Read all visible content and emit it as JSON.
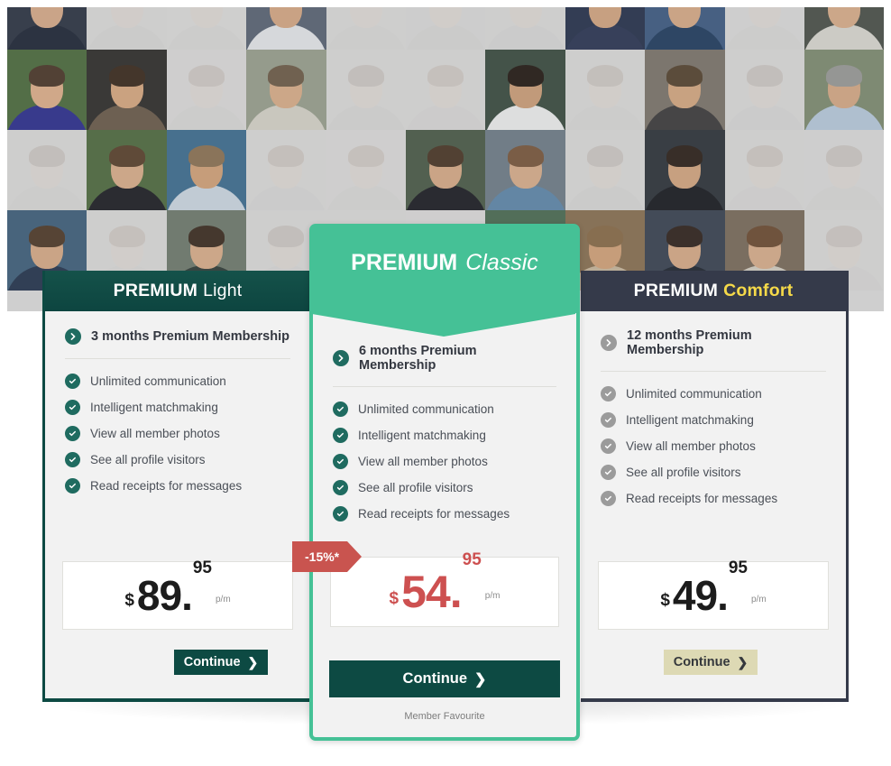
{
  "hero": {
    "name": "member-photo-mosaic",
    "columns": 11,
    "rows": 4,
    "tiles": [
      {
        "faded": false,
        "skin": "#d9ab87",
        "hair": "#3c2a1e",
        "bg": "#2c3340",
        "cloth": "#1d2433"
      },
      {
        "faded": true,
        "skin": "#e2bda0",
        "hair": "#6b4a30",
        "bg": "#c9c9c4",
        "cloth": "#b5b5ae"
      },
      {
        "faded": true,
        "skin": "#e5c2a6",
        "hair": "#8a6340",
        "bg": "#d0cfc9",
        "cloth": "#bdbcb6"
      },
      {
        "faded": false,
        "skin": "#d8a882",
        "hair": "#2e2119",
        "bg": "#5a6472",
        "cloth": "#e8e9ea"
      },
      {
        "faded": true,
        "skin": "#e6c4a8",
        "hair": "#7a5336",
        "bg": "#cdccc6",
        "cloth": "#b8b7b1"
      },
      {
        "faded": true,
        "skin": "#e3bfa3",
        "hair": "#4d372a",
        "bg": "#c6c5bf",
        "cloth": "#b2b1ab"
      },
      {
        "faded": true,
        "skin": "#e4c1a5",
        "hair": "#6f4d33",
        "bg": "#cbcac4",
        "cloth": "#b6b5af"
      },
      {
        "faded": false,
        "skin": "#d6a67f",
        "hair": "#34241a",
        "bg": "#253049",
        "cloth": "#2a3450"
      },
      {
        "faded": false,
        "skin": "#d9ab85",
        "hair": "#46301f",
        "bg": "#3d5a80",
        "cloth": "#1f3b5c"
      },
      {
        "faded": true,
        "skin": "#e5c3a7",
        "hair": "#7d5738",
        "bg": "#cecdc7",
        "cloth": "#b9b8b2"
      },
      {
        "faded": false,
        "skin": "#dcae88",
        "hair": "#56402c",
        "bg": "#4a4f46",
        "cloth": "#dcd9d0"
      },
      {
        "faded": false,
        "skin": "#e0b088",
        "hair": "#4b3524",
        "bg": "#4c6b3a",
        "cloth": "#2b2d8c"
      },
      {
        "faded": false,
        "skin": "#d9a87e",
        "hair": "#3a2819",
        "bg": "#2e2b27",
        "cloth": "#6a5a47"
      },
      {
        "faded": true,
        "skin": "#e6c5aa",
        "hair": "#7b5538",
        "bg": "#cfcec8",
        "cloth": "#bab9b3"
      },
      {
        "faded": false,
        "skin": "#dcae87",
        "hair": "#6e5b45",
        "bg": "#9aa08c",
        "cloth": "#d8d4c8"
      },
      {
        "faded": true,
        "skin": "#e3c0a4",
        "hair": "#6a4830",
        "bg": "#c8c7c1",
        "cloth": "#b4b3ad"
      },
      {
        "faded": true,
        "skin": "#e5c2a6",
        "hair": "#805a3b",
        "bg": "#cccbc5",
        "cloth": "#b7b6b0"
      },
      {
        "faded": false,
        "skin": "#cf9f76",
        "hair": "#22170f",
        "bg": "#3a4a3c",
        "cloth": "#f0f0ee"
      },
      {
        "faded": true,
        "skin": "#e4c1a5",
        "hair": "#74502f",
        "bg": "#cdccc6",
        "cloth": "#b8b7b1"
      },
      {
        "faded": false,
        "skin": "#d7a87f",
        "hair": "#55422c",
        "bg": "#7d7468",
        "cloth": "#3c3a38"
      },
      {
        "faded": true,
        "skin": "#e6c4a8",
        "hair": "#6d4b31",
        "bg": "#cbcac4",
        "cloth": "#b6b5af"
      },
      {
        "faded": false,
        "skin": "#d8aa83",
        "hair": "#9a9a96",
        "bg": "#7f8c6e",
        "cloth": "#b9cbdc"
      },
      {
        "faded": true,
        "skin": "#e5c3a7",
        "hair": "#6b4930",
        "bg": "#cdccc6",
        "cloth": "#b8b7b1"
      },
      {
        "faded": false,
        "skin": "#dcae88",
        "hair": "#5a4028",
        "bg": "#4f6b3c",
        "cloth": "#1c1c20"
      },
      {
        "faded": false,
        "skin": "#d5a377",
        "hair": "#8d7250",
        "bg": "#3d6d8e",
        "cloth": "#cfd9e2"
      },
      {
        "faded": true,
        "skin": "#e4c1a5",
        "hair": "#7a5436",
        "bg": "#cbcac4",
        "cloth": "#b6b5af"
      },
      {
        "faded": true,
        "skin": "#e6c5a9",
        "hair": "#82593a",
        "bg": "#cfcec8",
        "cloth": "#bab9b3"
      },
      {
        "faded": false,
        "skin": "#d9ab85",
        "hair": "#4a3522",
        "bg": "#4b5a44",
        "cloth": "#1b1b1f"
      },
      {
        "faded": false,
        "skin": "#dbae89",
        "hair": "#7a5638",
        "bg": "#6f7c86",
        "cloth": "#5f87a8"
      },
      {
        "faded": true,
        "skin": "#e3c0a4",
        "hair": "#6c4a31",
        "bg": "#c9c8c2",
        "cloth": "#b5b4ae"
      },
      {
        "faded": false,
        "skin": "#d6a67e",
        "hair": "#2b1e15",
        "bg": "#2d3136",
        "cloth": "#17181c"
      },
      {
        "faded": true,
        "skin": "#e5c2a6",
        "hair": "#785233",
        "bg": "#cccbc5",
        "cloth": "#b7b6b0"
      },
      {
        "faded": true,
        "skin": "#e6c4a8",
        "hair": "#6e4c32",
        "bg": "#cecdc7",
        "cloth": "#b9b8b2"
      },
      {
        "faded": false,
        "skin": "#d9ab85",
        "hair": "#4f3824",
        "bg": "#3f5f79",
        "cloth": "#23334a"
      },
      {
        "faded": true,
        "skin": "#e5c3a7",
        "hair": "#7f583a",
        "bg": "#cdccc6",
        "cloth": "#b8b7b1"
      },
      {
        "faded": false,
        "skin": "#dcae88",
        "hair": "#3b2a1c",
        "bg": "#6f7a6a",
        "cloth": "#2e3a33"
      },
      {
        "faded": true,
        "skin": "#e4c1a5",
        "hair": "#6a4830",
        "bg": "#cbcac4",
        "cloth": "#b6b5af"
      },
      {
        "faded": true,
        "skin": "#e3c0a4",
        "hair": "#745031",
        "bg": "#c9c8c2",
        "cloth": "#b5b4ae"
      },
      {
        "faded": true,
        "skin": "#e6c5a9",
        "hair": "#835a3b",
        "bg": "#cfcec8",
        "cloth": "#bab9b3"
      },
      {
        "faded": false,
        "skin": "#d7a87f",
        "hair": "#46321f",
        "bg": "#4a6b4f",
        "cloth": "#e6e2d8"
      },
      {
        "faded": false,
        "skin": "#d5a377",
        "hair": "#8a6a45",
        "bg": "#8a6f4e",
        "cloth": "#c9b79a"
      },
      {
        "faded": false,
        "skin": "#d9ab85",
        "hair": "#2f2118",
        "bg": "#38414e",
        "cloth": "#1d232c"
      },
      {
        "faded": false,
        "skin": "#dbae89",
        "hair": "#6d4a2e",
        "bg": "#7a6a58",
        "cloth": "#d5cec0"
      },
      {
        "faded": true,
        "skin": "#e5c2a6",
        "hair": "#7b5537",
        "bg": "#cccbc5",
        "cloth": "#b7b6b0"
      }
    ]
  },
  "plans": [
    {
      "id": "light",
      "title_bold": "PREMIUM",
      "title_soft": "Light",
      "duration": "3 months Premium Membership",
      "features": [
        "Unlimited communication",
        "Intelligent matchmaking",
        "View all member photos",
        "See all profile visitors",
        "Read receipts for messages"
      ],
      "price": {
        "currency": "$",
        "major": "89.",
        "cents": "95",
        "period": "p/m"
      },
      "cta_label": "Continue",
      "cta_arrow": "❯",
      "accent": "#0d4a43",
      "icon_color": "#1f6b60",
      "discount": null,
      "note": null
    },
    {
      "id": "classic",
      "title_bold": "PREMIUM",
      "title_soft": "Classic",
      "duration": "6 months Premium Membership",
      "features": [
        "Unlimited communication",
        "Intelligent matchmaking",
        "View all member photos",
        "See all profile visitors",
        "Read receipts for messages"
      ],
      "price": {
        "currency": "$",
        "major": "54.",
        "cents": "95",
        "period": "p/m"
      },
      "cta_label": "Continue",
      "cta_arrow": "❯",
      "accent": "#45c196",
      "icon_color": "#1f6b60",
      "discount": "-15%*",
      "note": "Member Favourite"
    },
    {
      "id": "comfort",
      "title_bold": "PREMIUM",
      "title_soft": "Comfort",
      "duration": "12 months Premium Membership",
      "features": [
        "Unlimited communication",
        "Intelligent matchmaking",
        "View all member photos",
        "See all profile visitors",
        "Read receipts for messages"
      ],
      "price": {
        "currency": "$",
        "major": "49.",
        "cents": "95",
        "period": "p/m"
      },
      "cta_label": "Continue",
      "cta_arrow": "❯",
      "accent": "#353a4a",
      "icon_color": "#9b9b9b",
      "discount": null,
      "note": null
    }
  ],
  "icons": {
    "duration": "chevron-right-circle-icon",
    "feature": "check-circle-icon",
    "cta": "chevron-right-icon"
  },
  "colors": {
    "teal_dark": "#0d4a43",
    "green_accent": "#45c196",
    "navy": "#353a4a",
    "gold": "#f5d949",
    "red": "#c9544f",
    "price_red": "#cd5050",
    "beige": "#ddd9b4",
    "card_bg": "#f2f2f2"
  }
}
